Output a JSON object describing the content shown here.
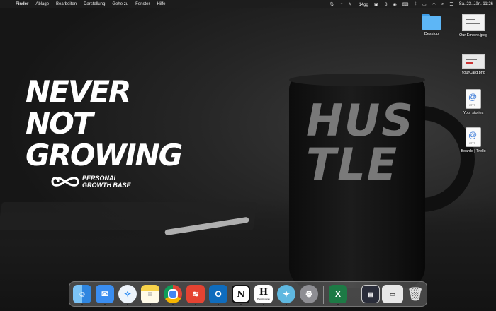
{
  "menubar": {
    "app_name": "Finder",
    "menus": [
      "Ablage",
      "Bearbeiten",
      "Darstellung",
      "Gehe zu",
      "Fenster",
      "Hilfe"
    ],
    "status": {
      "battery_percent": "14gg",
      "counter": "8",
      "datetime": "Sa. 23. Jän.  11:26"
    }
  },
  "wallpaper": {
    "headline": [
      "NEVER",
      "NOT",
      "GROWING"
    ],
    "brand": [
      "PERSONAL",
      "GROWTH BASE"
    ],
    "mug_text": [
      "HUS",
      "TLE"
    ]
  },
  "desktop_icons": [
    {
      "label": "Desktop",
      "icon": "folder-icon"
    },
    {
      "label": "Our Empire.jpeg",
      "icon": "image-file-icon"
    },
    {
      "label": "YourCard.png",
      "icon": "image-file-icon"
    },
    {
      "label": "Your stories",
      "icon": "webloc-icon"
    },
    {
      "label": "Boards | Trello",
      "icon": "webloc-icon"
    }
  ],
  "dock": {
    "apps": [
      {
        "name": "Finder",
        "icon": "finder-icon",
        "color": "#4aa3f0",
        "running": true
      },
      {
        "name": "Mail",
        "icon": "mail-icon",
        "color": "#3a8df0",
        "running": true
      },
      {
        "name": "Safari",
        "icon": "safari-icon",
        "color": "#2f8cf3",
        "running": true
      },
      {
        "name": "Notes",
        "icon": "notes-icon",
        "color": "#f7d24a",
        "running": true
      },
      {
        "name": "Chrome",
        "icon": "chrome-icon",
        "color": "#e8e8e8",
        "running": true
      },
      {
        "name": "Todoist",
        "icon": "todoist-icon",
        "color": "#e44332",
        "running": true
      },
      {
        "name": "Outlook",
        "icon": "outlook-icon",
        "color": "#0f6cbd",
        "running": true
      },
      {
        "name": "Notion",
        "icon": "notion-icon",
        "color": "#ffffff",
        "running": true
      },
      {
        "name": "Hemingway",
        "icon": "hemingway-icon",
        "color": "#ffffff",
        "running": true
      },
      {
        "name": "Tweetbot",
        "icon": "bird-icon",
        "color": "#5fb8e0",
        "running": true
      },
      {
        "name": "System Preferences",
        "icon": "gear-icon",
        "color": "#8e8e93",
        "running": false
      },
      {
        "name": "Excel",
        "icon": "excel-icon",
        "color": "#1d7a45",
        "running": true
      }
    ],
    "excel_letter": "X",
    "notion_letter": "N",
    "hemingway_letter": "H",
    "hemingway_caption": "Hemingway",
    "outlook_letter": "O"
  }
}
